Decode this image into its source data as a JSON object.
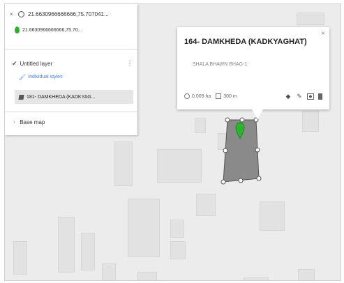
{
  "search": {
    "query": "21.6630966666666,75.707041...",
    "close_glyph": "×"
  },
  "result": {
    "text": "21.6630966666666,75.70..."
  },
  "layer": {
    "title": "Untitled layer",
    "styles_link": "Individual styles",
    "item_label": "181- DAMKHEDA (KADKYAG..."
  },
  "basemap": {
    "label": "Base map"
  },
  "popup": {
    "title": "164- DAMKHEDA (KADKYAGHAT)",
    "description": "SHALA BHAWN BHAG-1",
    "area": "0.009 ha",
    "perimeter": "300 m",
    "close_glyph": "×"
  },
  "colors": {
    "accent": "#3f7de0",
    "pin": "#2db22d",
    "polygon": "#8a8a8a"
  }
}
